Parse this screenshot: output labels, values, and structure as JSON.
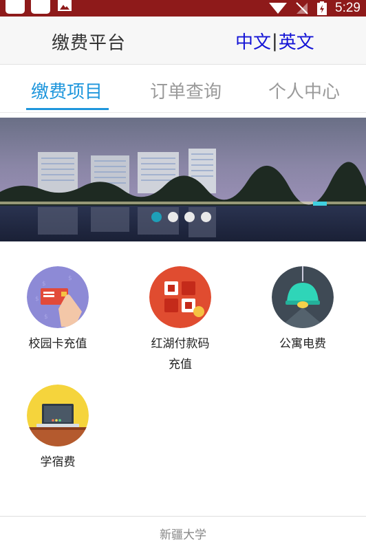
{
  "status_bar": {
    "time": "5:29"
  },
  "header": {
    "title": "缴费平台",
    "lang_options": [
      "中文",
      "英文"
    ],
    "lang_separator": "|"
  },
  "tabs": [
    {
      "label": "缴费项目",
      "active": true
    },
    {
      "label": "订单查询",
      "active": false
    },
    {
      "label": "个人中心",
      "active": false
    }
  ],
  "banner": {
    "slide_count": 4,
    "active_slide": 1
  },
  "payment_items": [
    {
      "label": "校园卡充值",
      "icon": "campus-card-icon"
    },
    {
      "label": "红湖付款码充值",
      "icon": "qr-code-icon"
    },
    {
      "label": "公寓电费",
      "icon": "lamp-icon"
    },
    {
      "label": "学宿费",
      "icon": "laptop-icon"
    }
  ],
  "footer": {
    "text": "新疆大学"
  },
  "colors": {
    "accent": "#1e96dc",
    "status_bar": "#8e1a1a",
    "lang_link": "#1414d6"
  }
}
